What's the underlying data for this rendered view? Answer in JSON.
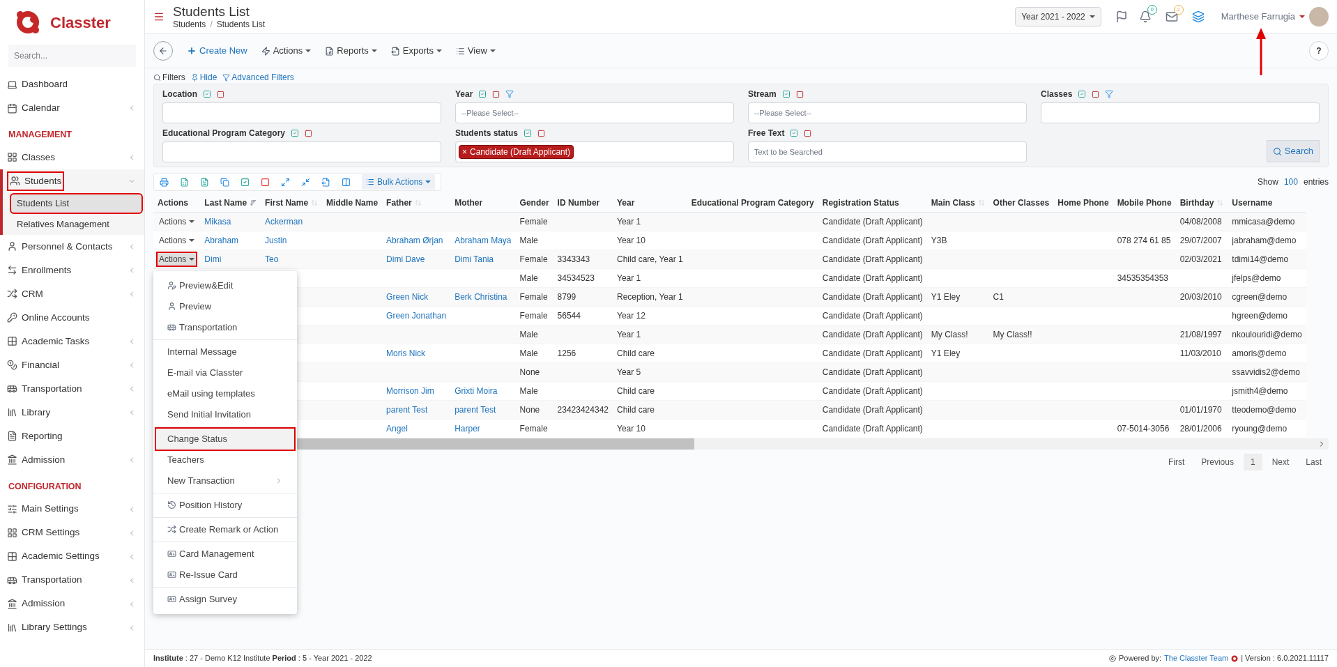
{
  "sidebar": {
    "logo": "Classter",
    "search": {
      "placeholder": "Search..."
    },
    "items": [
      {
        "kind": "item",
        "label": "Dashboard",
        "has_children": false
      },
      {
        "kind": "item",
        "label": "Calendar",
        "has_children": true
      },
      {
        "kind": "header",
        "label": "MANAGEMENT"
      },
      {
        "kind": "item",
        "label": "Classes",
        "has_children": true
      },
      {
        "kind": "item",
        "label": "Students",
        "has_children": true,
        "expanded": true,
        "highlighted": true,
        "children": [
          {
            "label": "Students List",
            "selected": true,
            "highlighted": true
          },
          {
            "label": "Relatives Management",
            "selected": false,
            "highlighted": false
          }
        ]
      },
      {
        "kind": "item",
        "label": "Personnel & Contacts",
        "has_children": true
      },
      {
        "kind": "item",
        "label": "Enrollments",
        "has_children": true
      },
      {
        "kind": "item",
        "label": "CRM",
        "has_children": true
      },
      {
        "kind": "item",
        "label": "Online Accounts",
        "has_children": false
      },
      {
        "kind": "item",
        "label": "Academic Tasks",
        "has_children": true
      },
      {
        "kind": "item",
        "label": "Financial",
        "has_children": true
      },
      {
        "kind": "item",
        "label": "Transportation",
        "has_children": true
      },
      {
        "kind": "item",
        "label": "Library",
        "has_children": true
      },
      {
        "kind": "item",
        "label": "Reporting",
        "has_children": false
      },
      {
        "kind": "item",
        "label": "Admission",
        "has_children": true
      },
      {
        "kind": "header",
        "label": "CONFIGURATION"
      },
      {
        "kind": "item",
        "label": "Main Settings",
        "has_children": true
      },
      {
        "kind": "item",
        "label": "CRM Settings",
        "has_children": true
      },
      {
        "kind": "item",
        "label": "Academic Settings",
        "has_children": true
      },
      {
        "kind": "item",
        "label": "Transportation",
        "has_children": true
      },
      {
        "kind": "item",
        "label": "Admission",
        "has_children": true
      },
      {
        "kind": "item",
        "label": "Library Settings",
        "has_children": true
      }
    ]
  },
  "header": {
    "title": "Students List",
    "breadcrumbs": [
      "Students",
      "Students List"
    ],
    "breadcrumb_separator": "/",
    "year_select": "Year 2021 - 2022",
    "notifications_badge": "0",
    "messages_badge": "2",
    "user_name": "Marthese Farrugia"
  },
  "toolbar": {
    "create": "Create New",
    "menus": [
      "Actions",
      "Reports",
      "Exports",
      "View"
    ],
    "help": "?"
  },
  "filters": {
    "title": "Filters",
    "hide": "Hide",
    "advanced": "Advanced Filters",
    "fields": [
      {
        "label": "Location",
        "has_filter_icon": false
      },
      {
        "label": "Year",
        "has_filter_icon": true,
        "placeholder": "--Please Select--"
      },
      {
        "label": "Stream",
        "has_filter_icon": false,
        "placeholder": "--Please Select--"
      },
      {
        "label": "Classes",
        "has_filter_icon": true
      },
      {
        "label": "Educational Program Category",
        "has_filter_icon": false
      },
      {
        "label": "Students status",
        "has_filter_icon": false,
        "tags": [
          "Candidate (Draft Applicant)"
        ],
        "tag_remove": "×"
      },
      {
        "label": "Free Text",
        "has_filter_icon": false,
        "placeholder": "Text to be Searched"
      }
    ],
    "search_button": "Search"
  },
  "table": {
    "bulk_actions": "Bulk Actions",
    "show": "Show",
    "page_size": "100",
    "entries": "entries",
    "columns": [
      {
        "label": "Actions",
        "sortable": false
      },
      {
        "label": "Last Name",
        "sortable": true,
        "sorted": true
      },
      {
        "label": "First Name",
        "sortable": true,
        "sorted": false
      },
      {
        "label": "Middle Name",
        "sortable": false
      },
      {
        "label": "Father",
        "sortable": true,
        "sorted": false
      },
      {
        "label": "Mother",
        "sortable": false
      },
      {
        "label": "Gender",
        "sortable": false
      },
      {
        "label": "ID Number",
        "sortable": false
      },
      {
        "label": "Year",
        "sortable": false
      },
      {
        "label": "Educational Program Category",
        "sortable": false
      },
      {
        "label": "Registration Status",
        "sortable": false
      },
      {
        "label": "Main Class",
        "sortable": true,
        "sorted": false
      },
      {
        "label": "Other Classes",
        "sortable": false
      },
      {
        "label": "Home Phone",
        "sortable": false
      },
      {
        "label": "Mobile Phone",
        "sortable": false
      },
      {
        "label": "Birthday",
        "sortable": true,
        "sorted": false
      },
      {
        "label": "Username",
        "sortable": false
      }
    ],
    "rows": [
      {
        "actions_highlighted": false,
        "menu_open": false,
        "cells": [
          "Actions",
          "Mikasa",
          "Ackerman",
          null,
          null,
          null,
          "Female",
          null,
          "Year 1",
          null,
          "Candidate (Draft Applicant)",
          null,
          null,
          null,
          null,
          "04/08/2008",
          "mmicasa@demo"
        ]
      },
      {
        "actions_highlighted": false,
        "menu_open": false,
        "cells": [
          "Actions",
          "Abraham",
          "Justin",
          null,
          "Abraham Ørjan",
          "Abraham Maya",
          "Male",
          null,
          "Year 10",
          null,
          "Candidate (Draft Applicant)",
          "Y3B",
          null,
          null,
          "078 274 61 85",
          "29/07/2007",
          "jabraham@demo"
        ]
      },
      {
        "actions_highlighted": true,
        "menu_open": true,
        "cells": [
          "Actions",
          "Dimi",
          "Teo",
          null,
          "Dimi Dave",
          "Dimi Tania",
          "Female",
          "3343343",
          "Child care, Year 1",
          null,
          "Candidate (Draft Applicant)",
          null,
          null,
          null,
          null,
          "02/03/2021",
          "tdimi14@demo"
        ]
      },
      {
        "cells": [
          null,
          null,
          null,
          null,
          null,
          null,
          "Male",
          "34534523",
          "Year 1",
          null,
          "Candidate (Draft Applicant)",
          null,
          null,
          null,
          "34535354353",
          null,
          "jfelps@demo"
        ]
      },
      {
        "cells": [
          null,
          null,
          null,
          null,
          "Green Nick",
          "Berk Christina",
          "Female",
          "8799",
          "Reception, Year 1",
          null,
          "Candidate (Draft Applicant)",
          "Y1 Eley",
          "C1",
          null,
          null,
          "20/03/2010",
          "cgreen@demo"
        ]
      },
      {
        "cells": [
          null,
          null,
          null,
          null,
          "Green Jonathan",
          null,
          "Female",
          "56544",
          "Year 12",
          null,
          "Candidate (Draft Applicant)",
          null,
          null,
          null,
          null,
          null,
          "hgreen@demo"
        ]
      },
      {
        "cells": [
          null,
          null,
          null,
          null,
          null,
          null,
          "Male",
          null,
          "Year 1",
          null,
          "Candidate (Draft Applicant)",
          "My Class!",
          "My Class!!",
          null,
          null,
          "21/08/1997",
          "nkoulouridi@demo"
        ]
      },
      {
        "cells": [
          null,
          null,
          null,
          null,
          "Moris Nick",
          null,
          "Male",
          "1256",
          "Child care",
          null,
          "Candidate (Draft Applicant)",
          "Y1 Eley",
          null,
          null,
          null,
          "11/03/2010",
          "amoris@demo"
        ]
      },
      {
        "cells": [
          null,
          null,
          null,
          null,
          null,
          null,
          "None",
          null,
          "Year 5",
          null,
          "Candidate (Draft Applicant)",
          null,
          null,
          null,
          null,
          null,
          "ssavvidis2@demo"
        ]
      },
      {
        "cells": [
          null,
          null,
          null,
          null,
          "Morrison Jim",
          "Grixti Moira",
          "Male",
          null,
          "Child care",
          null,
          "Candidate (Draft Applicant)",
          null,
          null,
          null,
          null,
          null,
          "jsmith4@demo"
        ]
      },
      {
        "cells": [
          null,
          null,
          null,
          null,
          "parent Test",
          "parent Test",
          "None",
          "23423424342",
          "Child care",
          null,
          "Candidate (Draft Applicant)",
          null,
          null,
          null,
          null,
          "01/01/1970",
          "tteodemo@demo"
        ]
      },
      {
        "cells": [
          null,
          null,
          null,
          null,
          "Angel",
          "Harper",
          "Female",
          null,
          "Year 10",
          null,
          "Candidate (Draft Applicant)",
          null,
          null,
          null,
          "07-5014-3056",
          "28/01/2006",
          "ryoung@demo"
        ]
      }
    ],
    "pagination": [
      {
        "label": "First",
        "selected": false
      },
      {
        "label": "Previous",
        "selected": false
      },
      {
        "label": "1",
        "selected": true
      },
      {
        "label": "Next",
        "selected": false
      },
      {
        "label": "Last",
        "selected": false
      }
    ]
  },
  "action_menu": {
    "groups": [
      [
        {
          "label": "Preview&Edit",
          "kind": "icon"
        },
        {
          "label": "Preview",
          "kind": "icon"
        },
        {
          "label": "Transportation",
          "kind": "icon"
        }
      ],
      [
        {
          "label": "Internal Message",
          "kind": "plain"
        },
        {
          "label": "E-mail via Classter",
          "kind": "plain"
        },
        {
          "label": "eMail using templates",
          "kind": "plain"
        },
        {
          "label": "Send Initial Invitation",
          "kind": "plain"
        }
      ],
      [
        {
          "label": "Change Status",
          "kind": "plain",
          "highlighted": true
        },
        {
          "label": "Teachers",
          "kind": "plain",
          "highlighted": false
        },
        {
          "label": "New Transaction",
          "kind": "submenu"
        }
      ],
      [
        {
          "label": "Position History",
          "kind": "icon"
        }
      ],
      [
        {
          "label": "Create Remark or Action",
          "kind": "icon"
        }
      ],
      [
        {
          "label": "Card Management",
          "kind": "icon"
        },
        {
          "label": "Re-Issue Card",
          "kind": "icon"
        }
      ],
      [
        {
          "label": "Assign Survey",
          "kind": "icon"
        }
      ]
    ]
  },
  "footer": {
    "info": "**Institute** : 27 - Demo K12 Institute **Period** : 5 - Year 2021 - 2022",
    "powered_by": "Powered by:",
    "team_link": "The Classter Team",
    "version": "| Version : 6.0.2021.11117"
  }
}
